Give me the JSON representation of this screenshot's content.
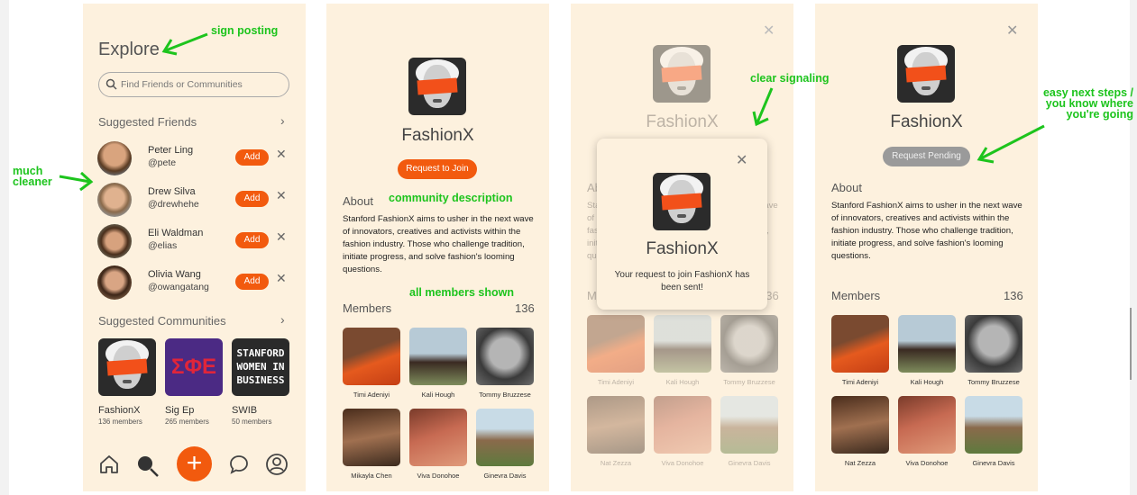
{
  "colors": {
    "background": "#fdf1de",
    "accent": "#f25a0e",
    "annotation": "#1dc41d",
    "pending": "#9a9a9a"
  },
  "screen1": {
    "title": "Explore",
    "search_placeholder": "Find Friends or Communities",
    "suggested_friends": "Suggested Friends",
    "friends": [
      {
        "name": "Peter Ling",
        "handle": "@pete",
        "add": "Add"
      },
      {
        "name": "Drew Silva",
        "handle": "@drewhehe",
        "add": "Add"
      },
      {
        "name": "Eli Waldman",
        "handle": "@elias",
        "add": "Add"
      },
      {
        "name": "Olivia Wang",
        "handle": "@owangatang",
        "add": "Add"
      }
    ],
    "suggested_communities": "Suggested Communities",
    "communities": [
      {
        "name": "FashionX",
        "members": "136 members"
      },
      {
        "name": "Sig Ep",
        "members": "265 members",
        "logo_text": "ΣΦΕ"
      },
      {
        "name": "SWIB",
        "members": "50 members",
        "logo_lines": [
          "STANFORD",
          "WOMEN IN",
          "BUSINESS"
        ]
      }
    ],
    "nav_icons": [
      "home-icon",
      "search-icon",
      "plus-icon",
      "chat-icon",
      "profile-icon"
    ]
  },
  "community": {
    "name": "FashionX",
    "request_button": "Request to Join",
    "pending_button": "Request Pending",
    "about": "About",
    "description": "Stanford FashionX aims to usher in the next wave of innovators, creatives and activists within the fashion industry. Those who challenge tradition, initiate progress, and solve fashion's looming questions.",
    "members_label": "Members",
    "members_count": "136",
    "members": [
      "Timi Adeniyi",
      "Kali Hough",
      "Tommy Bruzzese",
      "Mikayla Chen",
      "Viva Donohoe",
      "Ginevra Davis"
    ],
    "members_alt": [
      "Timi Adeniyi",
      "Kali Hough",
      "Tommy Bruzzese",
      "Nat Zezza",
      "Viva Donohoe",
      "Ginevra Davis"
    ]
  },
  "modal": {
    "title": "FashionX",
    "message": "Your request to join FashionX has been sent!"
  },
  "annotations": {
    "sign_posting": "sign posting",
    "much_cleaner": "much cleaner",
    "community_description": "community description",
    "all_members_shown": "all members shown",
    "clear_signaling": "clear signaling",
    "easy_next_steps": "easy next steps / you know where you're going"
  }
}
